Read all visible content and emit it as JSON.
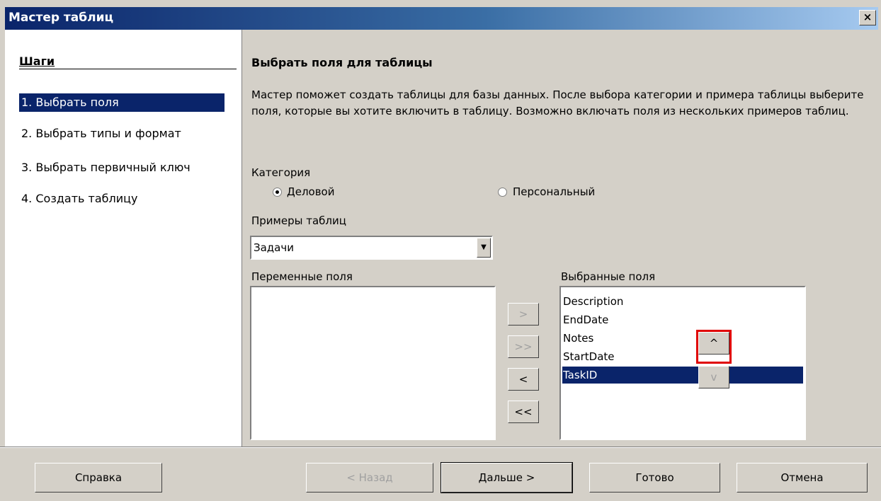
{
  "window": {
    "title": "Мастер таблиц",
    "close_glyph": "×"
  },
  "steps": {
    "header": "Шаги",
    "items": [
      {
        "label": "1.  Выбрать поля"
      },
      {
        "label": "2.  Выбрать типы и формат"
      },
      {
        "label": "3.  Выбрать первичный ключ"
      },
      {
        "label": "4.  Создать таблицу"
      }
    ]
  },
  "main": {
    "heading": "Выбрать поля для таблицы",
    "description": "Мастер поможет создать таблицы для базы данных. После выбора категории и примера таблицы выберите поля, которые вы хотите включить в таблицу. Возможно включать поля из нескольких примеров таблиц.",
    "category_label": "Категория",
    "radio_business": "Деловой",
    "radio_personal": "Персональный",
    "sample_tables_label": "Примеры таблиц",
    "sample_tables_value": "Задачи",
    "available_fields_label": "Переменные поля",
    "selected_fields_label": "Выбранные поля",
    "selected_fields": [
      "Description",
      "EndDate",
      "Notes",
      "StartDate",
      "TaskID"
    ],
    "btn_add": ">",
    "btn_add_all": ">>",
    "btn_remove": "<",
    "btn_remove_all": "<<",
    "btn_up": "^",
    "btn_down": "v"
  },
  "footer": {
    "help": "Справка",
    "back": "< Назад",
    "next": "Дальше >",
    "finish": "Готово",
    "cancel": "Отмена"
  }
}
